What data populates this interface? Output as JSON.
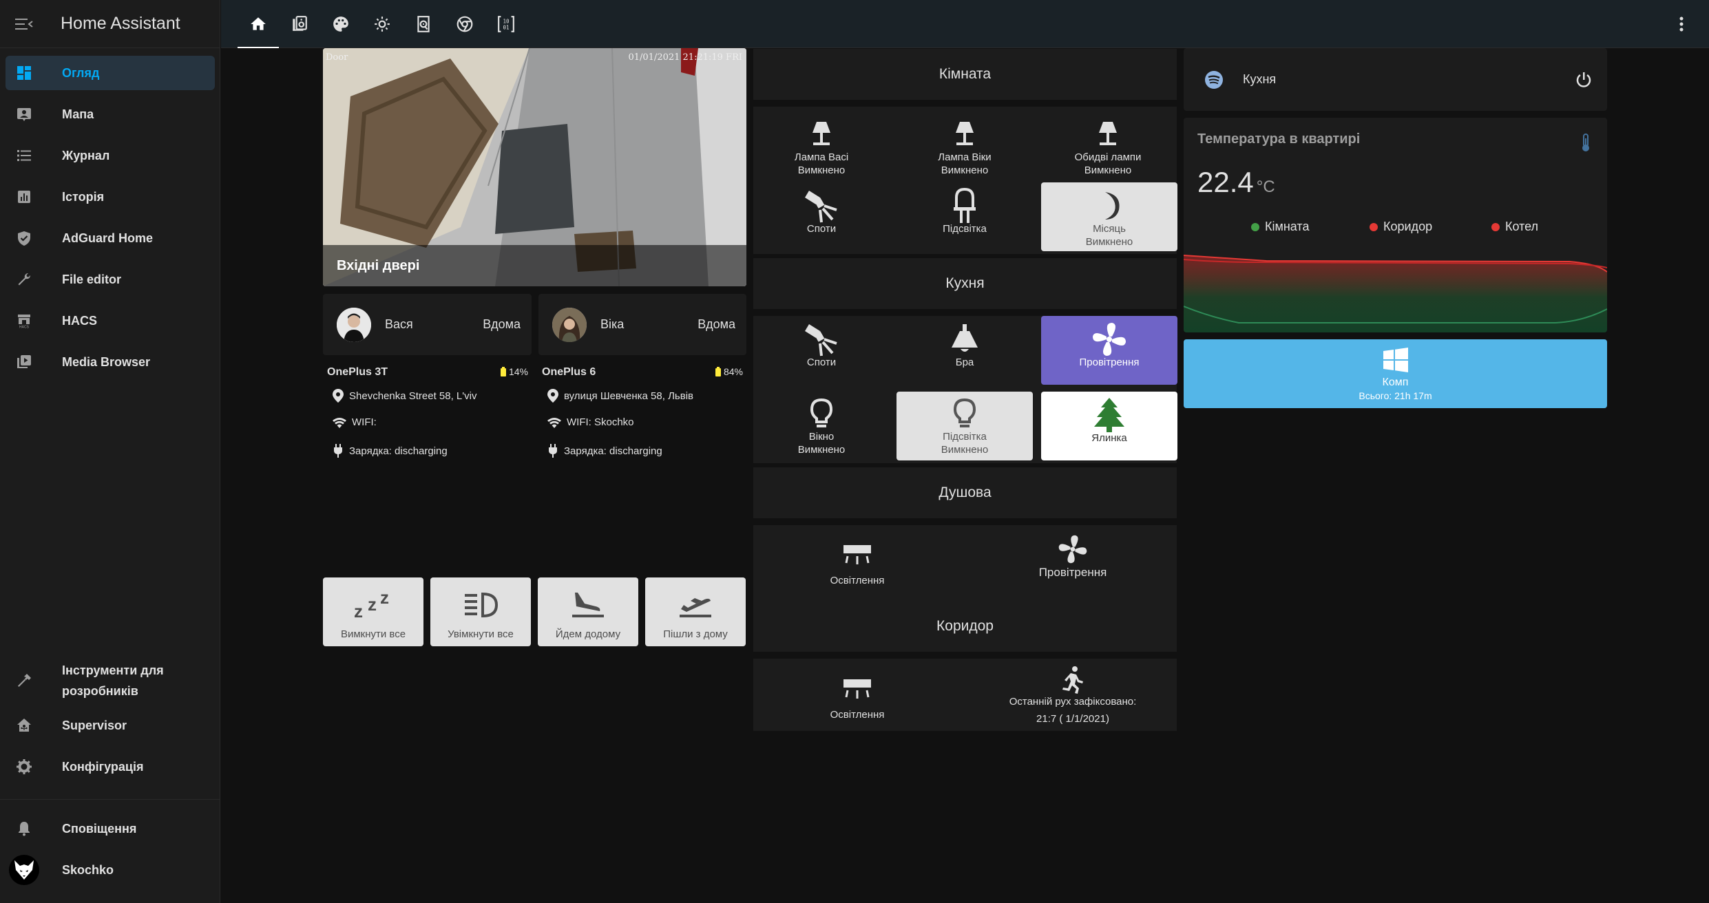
{
  "app": {
    "title": "Home Assistant"
  },
  "sidebar": {
    "items": [
      {
        "label": "Огляд",
        "icon": "dashboard-icon"
      },
      {
        "label": "Мапа",
        "icon": "map-icon"
      },
      {
        "label": "Журнал",
        "icon": "logbook-icon"
      },
      {
        "label": "Історія",
        "icon": "history-icon"
      },
      {
        "label": "AdGuard Home",
        "icon": "shield-icon"
      },
      {
        "label": "File editor",
        "icon": "wrench-icon"
      },
      {
        "label": "HACS",
        "icon": "hacs-icon"
      },
      {
        "label": "Media Browser",
        "icon": "media-icon"
      }
    ],
    "bottom": [
      {
        "label": "Інструменти для",
        "label2": "розробників"
      },
      {
        "label": "Supervisor"
      },
      {
        "label": "Конфігурація"
      }
    ],
    "notifications": "Сповіщення",
    "user": "Skochko"
  },
  "topbar": {
    "tabs": [
      "home-tab",
      "speaker-tab",
      "palette-tab",
      "weather-tab",
      "sd-card-tab",
      "chrome-tab",
      "binary-tab"
    ]
  },
  "camera": {
    "title": "Вхідні двері",
    "label": "Door",
    "timestamp": "01/01/2021 21:21:19 FRI"
  },
  "persons": [
    {
      "name": "Вася",
      "state": "Вдома"
    },
    {
      "name": "Віка",
      "state": "Вдома"
    }
  ],
  "devices": [
    {
      "title": "OnePlus 3T",
      "battery": "14%",
      "location": "Shevchenka Street 58, L'viv",
      "wifi": "WIFI:",
      "charging": "Зарядка: discharging"
    },
    {
      "title": "OnePlus 6",
      "battery": "84%",
      "location": "вулиця Шевченка 58, Львів",
      "wifi": "WIFI: Skochko",
      "charging": "Зарядка: discharging"
    }
  ],
  "scripts": [
    {
      "label": "Вимкнути все",
      "icon": "sleep-icon"
    },
    {
      "label": "Увімкнути все",
      "icon": "headlight-icon"
    },
    {
      "label": "Йдем додому",
      "icon": "airplane-landing-icon"
    },
    {
      "label": "Пішли з дому",
      "icon": "airplane-takeoff-icon"
    }
  ],
  "rooms": {
    "kimnata": {
      "title": "Кімната",
      "entities": [
        {
          "name": "Лампа Васі",
          "state": "Вимкнено"
        },
        {
          "name": "Лампа Віки",
          "state": "Вимкнено"
        },
        {
          "name": "Обидві лампи",
          "state": "Вимкнено"
        },
        {
          "name": "Споти"
        },
        {
          "name": "Підсвітка"
        },
        {
          "name": "Місяць",
          "state": "Вимкнено"
        }
      ]
    },
    "kukhnia": {
      "title": "Кухня",
      "entities": [
        {
          "name": "Споти"
        },
        {
          "name": "Бра"
        },
        {
          "name": "Провітрення"
        },
        {
          "name": "Вікно",
          "state": "Вимкнено"
        },
        {
          "name": "Підсвітка",
          "state": "Вимкнено"
        },
        {
          "name": "Ялинка"
        }
      ]
    },
    "dushova": {
      "title": "Душова",
      "entities": [
        {
          "name": "Освітлення"
        },
        {
          "name": "Провітрення"
        }
      ]
    },
    "korydor": {
      "title": "Коридор",
      "entities": [
        {
          "name": "Освітлення"
        },
        {
          "name": "Останній рух зафіксовано:",
          "state": "21:7 ( 1/1/2021)"
        }
      ]
    }
  },
  "spotify": {
    "name": "Кухня"
  },
  "temperature": {
    "title": "Температура в квартирі",
    "value": "22.4",
    "unit": "°C",
    "legend": [
      {
        "label": "Кімната",
        "color": "#43a047"
      },
      {
        "label": "Коридор",
        "color": "#e53935"
      },
      {
        "label": "Котел",
        "color": "#e53935"
      }
    ]
  },
  "komp": {
    "name": "Комп",
    "state": "Всього: 21h 17m"
  },
  "colors": {
    "accent": "#03a9f4",
    "fan_active": "#6f64c7",
    "komp_bg": "#54b6e8",
    "tree": "#2e7d32"
  }
}
